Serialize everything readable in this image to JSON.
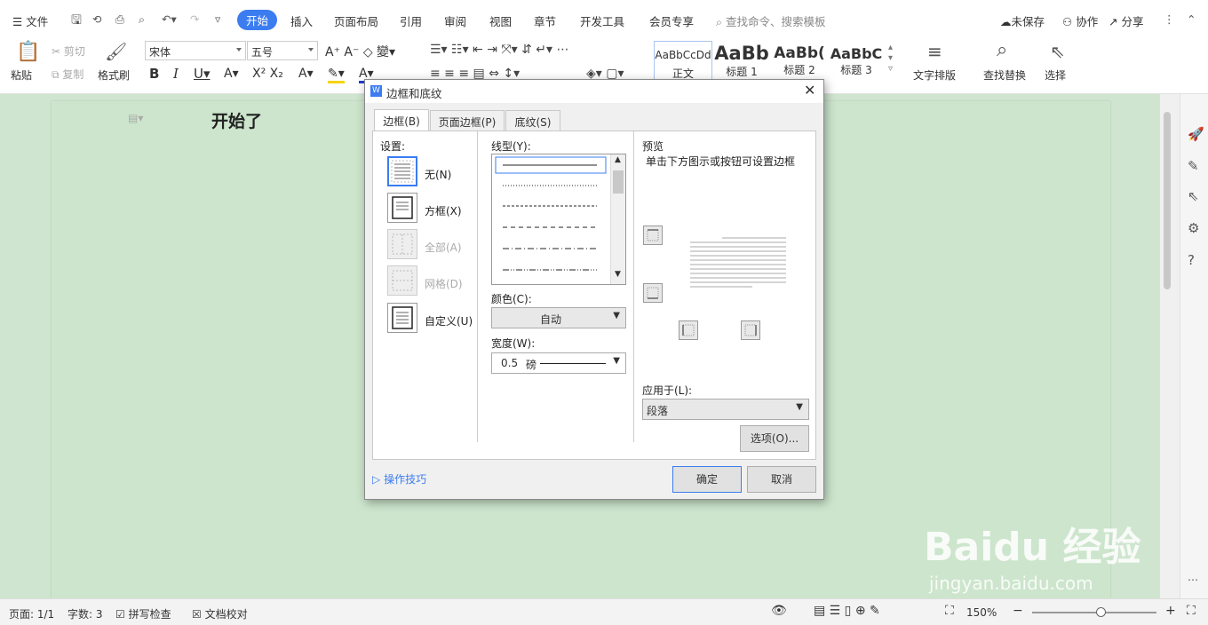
{
  "menubar": {
    "file": "文件",
    "tabs": [
      "开始",
      "插入",
      "页面布局",
      "引用",
      "审阅",
      "视图",
      "章节",
      "开发工具",
      "会员专享"
    ],
    "search_placeholder": "查找命令、搜索模板",
    "unsaved": "未保存",
    "collab": "协作",
    "share": "分享"
  },
  "ribbon": {
    "paste": "粘贴",
    "cut": "剪切",
    "copy": "复制",
    "format_painter": "格式刷",
    "font": "宋体",
    "size": "五号",
    "styles": [
      {
        "preview": "AaBbCcDd",
        "name": "正文"
      },
      {
        "preview": "AaBb",
        "name": "标题 1"
      },
      {
        "preview": "AaBb(",
        "name": "标题 2"
      },
      {
        "preview": "AaBbC",
        "name": "标题 3"
      }
    ],
    "text_layout": "文字排版",
    "find_replace": "查找替换",
    "select": "选择"
  },
  "document": {
    "text": "开始了"
  },
  "dialog": {
    "title": "边框和底纹",
    "tabs": [
      "边框(B)",
      "页面边框(P)",
      "底纹(S)"
    ],
    "settings_label": "设置:",
    "settings": [
      {
        "label": "无(N)",
        "enabled": true
      },
      {
        "label": "方框(X)",
        "enabled": true
      },
      {
        "label": "全部(A)",
        "enabled": false
      },
      {
        "label": "网格(D)",
        "enabled": false
      },
      {
        "label": "自定义(U)",
        "enabled": true
      }
    ],
    "line_style_label": "线型(Y):",
    "color_label": "颜色(C):",
    "color_value": "自动",
    "width_label": "宽度(W):",
    "width_value": "0.5",
    "width_unit": "磅",
    "preview_label": "预览",
    "preview_hint": "单击下方图示或按钮可设置边框",
    "apply_label": "应用于(L):",
    "apply_value": "段落",
    "options_button": "选项(O)...",
    "tips": "操作技巧",
    "ok": "确定",
    "cancel": "取消"
  },
  "statusbar": {
    "page": "页面: 1/1",
    "words": "字数: 3",
    "spell": "拼写检查",
    "proof": "文档校对",
    "zoom": "150%"
  },
  "watermark": {
    "brand": "Baidu 经验",
    "url": "jingyan.baidu.com"
  },
  "colors": {
    "accent": "#3b7cf0",
    "doc_bg": "#cce5cc"
  }
}
